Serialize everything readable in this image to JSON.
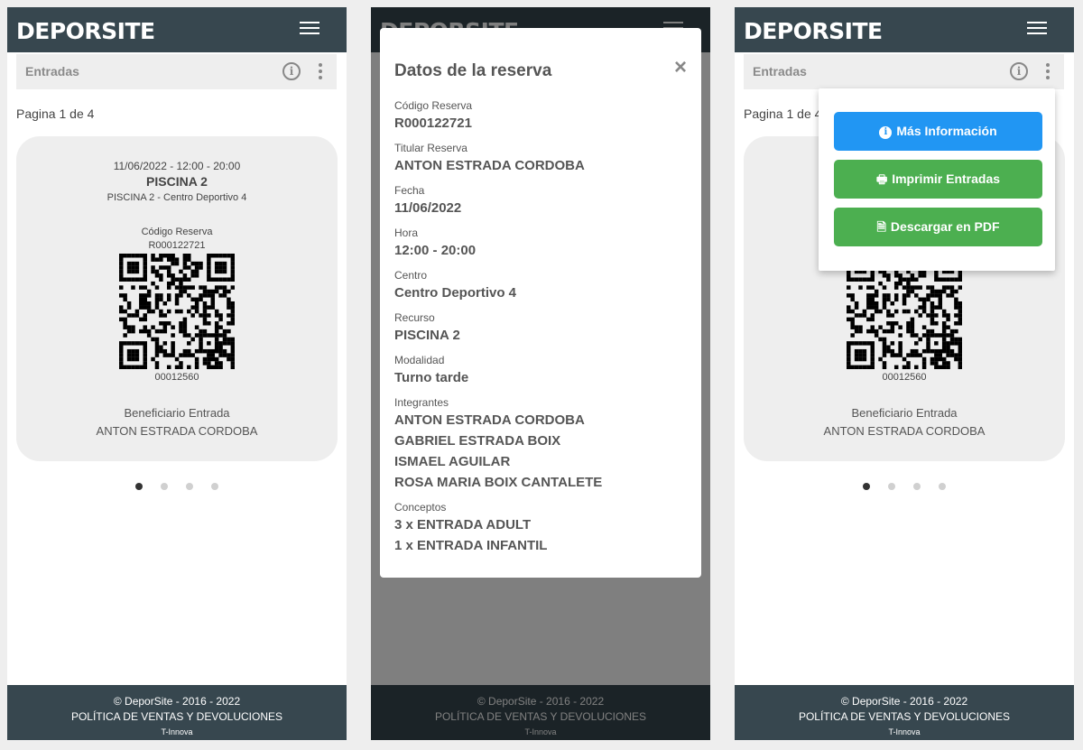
{
  "app": {
    "logo": "DEPORSITE",
    "section_title": "Entradas"
  },
  "pager": {
    "text": "Pagina 1 de 4",
    "text_clipped": "Pagina 1 de 4",
    "current_page": 1,
    "total_pages": 4
  },
  "ticket": {
    "datetime": "11/06/2022 - 12:00 - 20:00",
    "resource": "PISCINA 2",
    "center": "PISCINA 2 - Centro Deportivo 4",
    "code_label": "Código Reserva",
    "code": "R000122721",
    "ticket_number": "00012560",
    "beneficiary_label": "Beneficiario Entrada",
    "beneficiary": "ANTON ESTRADA CORDOBA"
  },
  "footer": {
    "copyright": "© DeporSite - 2016 - 2022",
    "policy": "POLÍTICA DE VENTAS Y DEVOLUCIONES",
    "brand": "T-Innova"
  },
  "modal": {
    "title": "Datos de la reserva",
    "close": "×",
    "fields": [
      {
        "label": "Código Reserva",
        "values": [
          "R000122721"
        ]
      },
      {
        "label": "Titular Reserva",
        "values": [
          "ANTON ESTRADA CORDOBA"
        ]
      },
      {
        "label": "Fecha",
        "values": [
          "11/06/2022"
        ]
      },
      {
        "label": "Hora",
        "values": [
          "12:00 - 20:00"
        ]
      },
      {
        "label": "Centro",
        "values": [
          "Centro Deportivo 4"
        ]
      },
      {
        "label": "Recurso",
        "values": [
          "PISCINA 2"
        ]
      },
      {
        "label": "Modalidad",
        "values": [
          "Turno tarde"
        ]
      },
      {
        "label": "Integrantes",
        "values": [
          "ANTON ESTRADA CORDOBA",
          "GABRIEL ESTRADA BOIX",
          "ISMAEL AGUILAR",
          "ROSA MARIA BOIX CANTALETE"
        ]
      },
      {
        "label": "Conceptos",
        "values": [
          "3 x ENTRADA ADULT",
          "1 x ENTRADA INFANTIL"
        ]
      }
    ]
  },
  "menu": {
    "more_info": "Más Información",
    "print": "Imprimir Entradas",
    "download": "Descargar en PDF"
  },
  "icons": {
    "info": "info-icon",
    "more": "kebab-menu-icon",
    "menu": "hamburger-icon",
    "print": "printer-icon",
    "pdf": "pdf-file-icon"
  },
  "colors": {
    "topbar": "#37474f",
    "primary": "#2196f3",
    "success": "#4caf50"
  }
}
